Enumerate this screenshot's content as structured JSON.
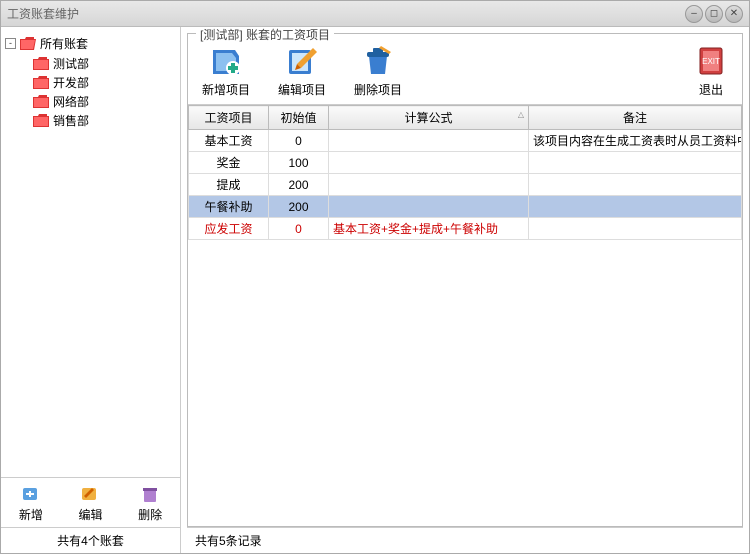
{
  "window": {
    "title": "工资账套维护"
  },
  "sidebar": {
    "root": "所有账套",
    "items": [
      "测试部",
      "开发部",
      "网络部",
      "销售部"
    ],
    "buttons": {
      "add": "新增",
      "edit": "编辑",
      "delete": "删除"
    },
    "status": "共有4个账套"
  },
  "main": {
    "group_label": "[测试部] 账套的工资项目",
    "toolbar": {
      "add": "新增项目",
      "edit": "编辑项目",
      "delete": "删除项目",
      "exit": "退出"
    },
    "columns": {
      "name": "工资项目",
      "init": "初始值",
      "formula": "计算公式",
      "remark": "备注"
    },
    "rows": [
      {
        "name": "基本工资",
        "init": "0",
        "formula": "",
        "remark": "该项目内容在生成工资表时从员工资料中自动导入",
        "selected": false,
        "red": false
      },
      {
        "name": "奖金",
        "init": "100",
        "formula": "",
        "remark": "",
        "selected": false,
        "red": false
      },
      {
        "name": "提成",
        "init": "200",
        "formula": "",
        "remark": "",
        "selected": false,
        "red": false
      },
      {
        "name": "午餐补助",
        "init": "200",
        "formula": "",
        "remark": "",
        "selected": true,
        "red": false
      },
      {
        "name": "应发工资",
        "init": "0",
        "formula": "基本工资+奖金+提成+午餐补助",
        "remark": "",
        "selected": false,
        "red": true
      }
    ],
    "status": "共有5条记录"
  }
}
